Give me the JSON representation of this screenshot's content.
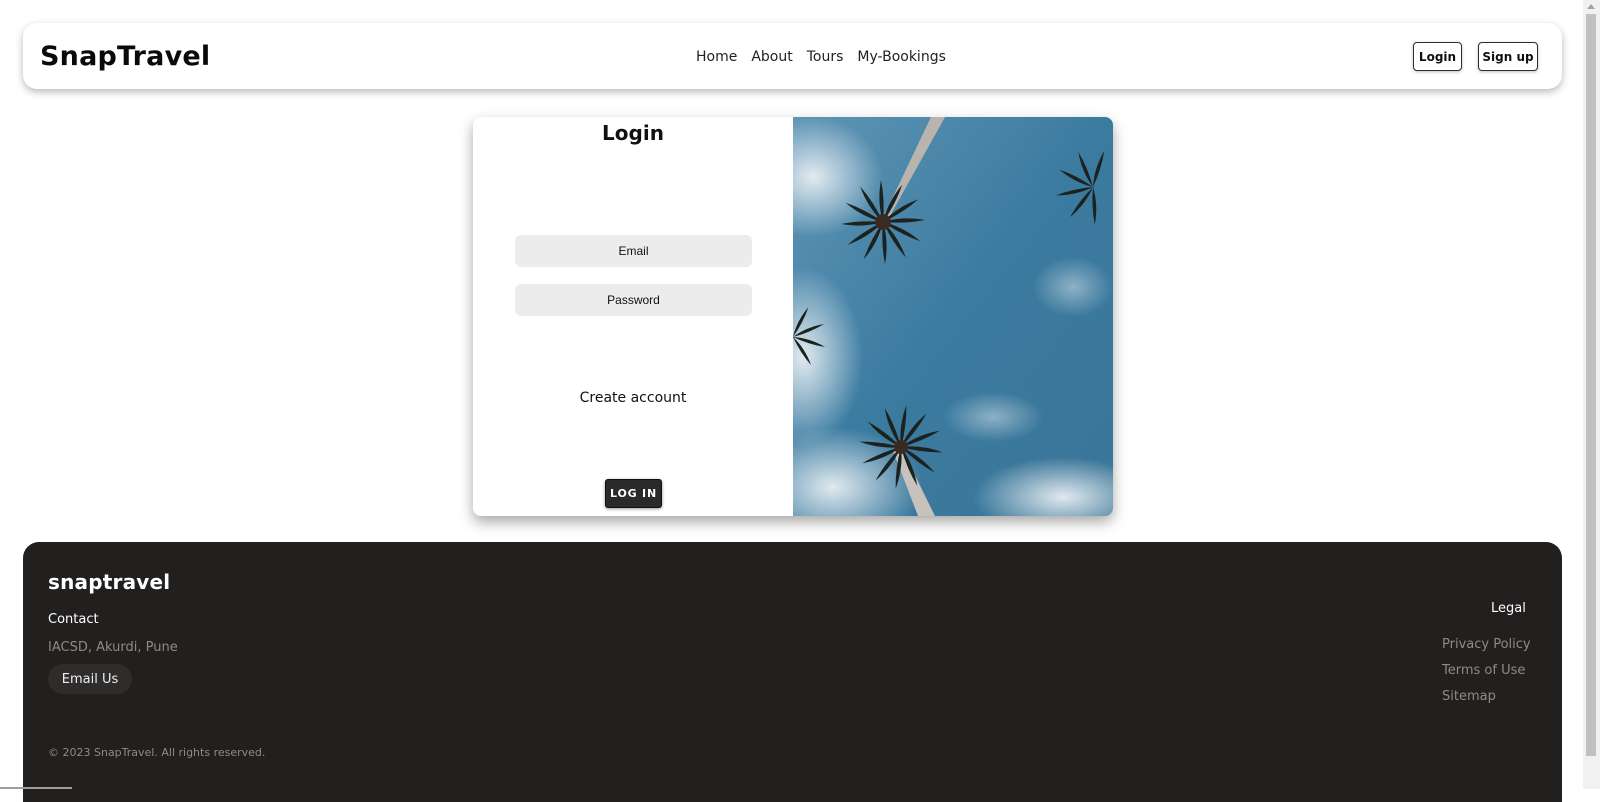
{
  "header": {
    "brand": "SnapTravel",
    "nav": [
      "Home",
      "About",
      "Tours",
      "My-Bookings"
    ],
    "login_label": "Login",
    "signup_label": "Sign up"
  },
  "login_card": {
    "title": "Login",
    "email_placeholder": "Email",
    "password_placeholder": "Password",
    "create_account": "Create account",
    "submit_label": "LOG IN",
    "image_icon": "palm-trees-photo"
  },
  "footer": {
    "logo": "snaptravel",
    "contact_heading": "Contact",
    "address": "IACSD, Akurdi, Pune",
    "email_button": "Email Us",
    "copyright": "© 2023 SnapTravel. All rights reserved.",
    "legal_heading": "Legal",
    "legal_links": [
      "Privacy Policy",
      "Terms of Use",
      "Sitemap"
    ]
  },
  "colors": {
    "footer_bg": "#221f1f",
    "sky": "#3c7ea1",
    "button_dark": "#2a2a2a"
  }
}
